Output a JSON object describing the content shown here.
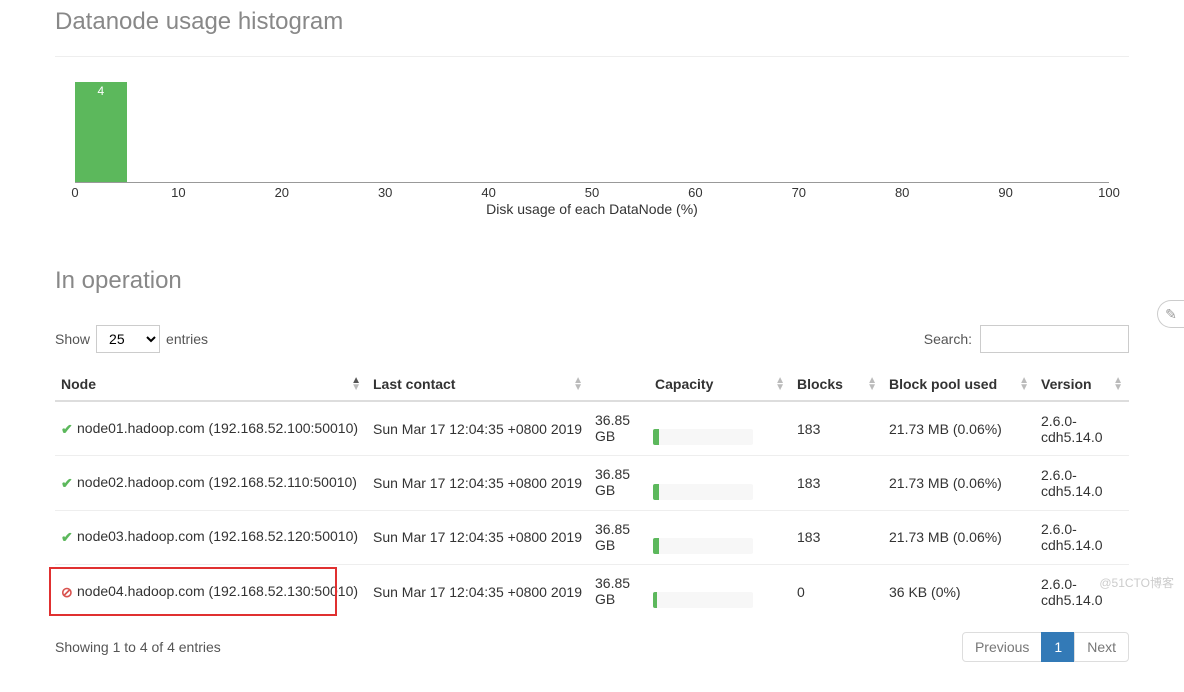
{
  "histogram": {
    "title": "Datanode usage histogram",
    "xlabel": "Disk usage of each DataNode (%)"
  },
  "chart_data": {
    "type": "bar",
    "x_ticks": [
      0,
      10,
      20,
      30,
      40,
      50,
      60,
      70,
      80,
      90,
      100
    ],
    "categories": [
      "0-5"
    ],
    "values": [
      4
    ],
    "xlabel": "Disk usage of each DataNode (%)",
    "ylabel": "",
    "title": "Datanode usage histogram",
    "xlim": [
      0,
      100
    ]
  },
  "operation": {
    "title": "In operation",
    "show_label": "Show",
    "entries_label": "entries",
    "entries_value": "25",
    "search_label": "Search:",
    "search_value": "",
    "columns": [
      "Node",
      "Last contact",
      "Capacity",
      "Blocks",
      "Block pool used",
      "Version"
    ],
    "rows": [
      {
        "status": "ok",
        "node": "node01.hadoop.com (192.168.52.100:50010)",
        "last_contact": "Sun Mar 17 12:04:35 +0800 2019",
        "capacity": "36.85 GB",
        "cap_pct": 6,
        "blocks": "183",
        "pool": "21.73 MB (0.06%)",
        "version": "2.6.0-cdh5.14.0"
      },
      {
        "status": "ok",
        "node": "node02.hadoop.com (192.168.52.110:50010)",
        "last_contact": "Sun Mar 17 12:04:35 +0800 2019",
        "capacity": "36.85 GB",
        "cap_pct": 6,
        "blocks": "183",
        "pool": "21.73 MB (0.06%)",
        "version": "2.6.0-cdh5.14.0"
      },
      {
        "status": "ok",
        "node": "node03.hadoop.com (192.168.52.120:50010)",
        "last_contact": "Sun Mar 17 12:04:35 +0800 2019",
        "capacity": "36.85 GB",
        "cap_pct": 6,
        "blocks": "183",
        "pool": "21.73 MB (0.06%)",
        "version": "2.6.0-cdh5.14.0"
      },
      {
        "status": "bad",
        "node": "node04.hadoop.com (192.168.52.130:50010)",
        "last_contact": "Sun Mar 17 12:04:35 +0800 2019",
        "capacity": "36.85 GB",
        "cap_pct": 4,
        "blocks": "0",
        "pool": "36 KB (0%)",
        "version": "2.6.0-cdh5.14.0",
        "highlight": true
      }
    ],
    "info": "Showing 1 to 4 of 4 entries",
    "pagination": {
      "prev": "Previous",
      "current": "1",
      "next": "Next"
    }
  },
  "watermark": "@51CTO博客"
}
